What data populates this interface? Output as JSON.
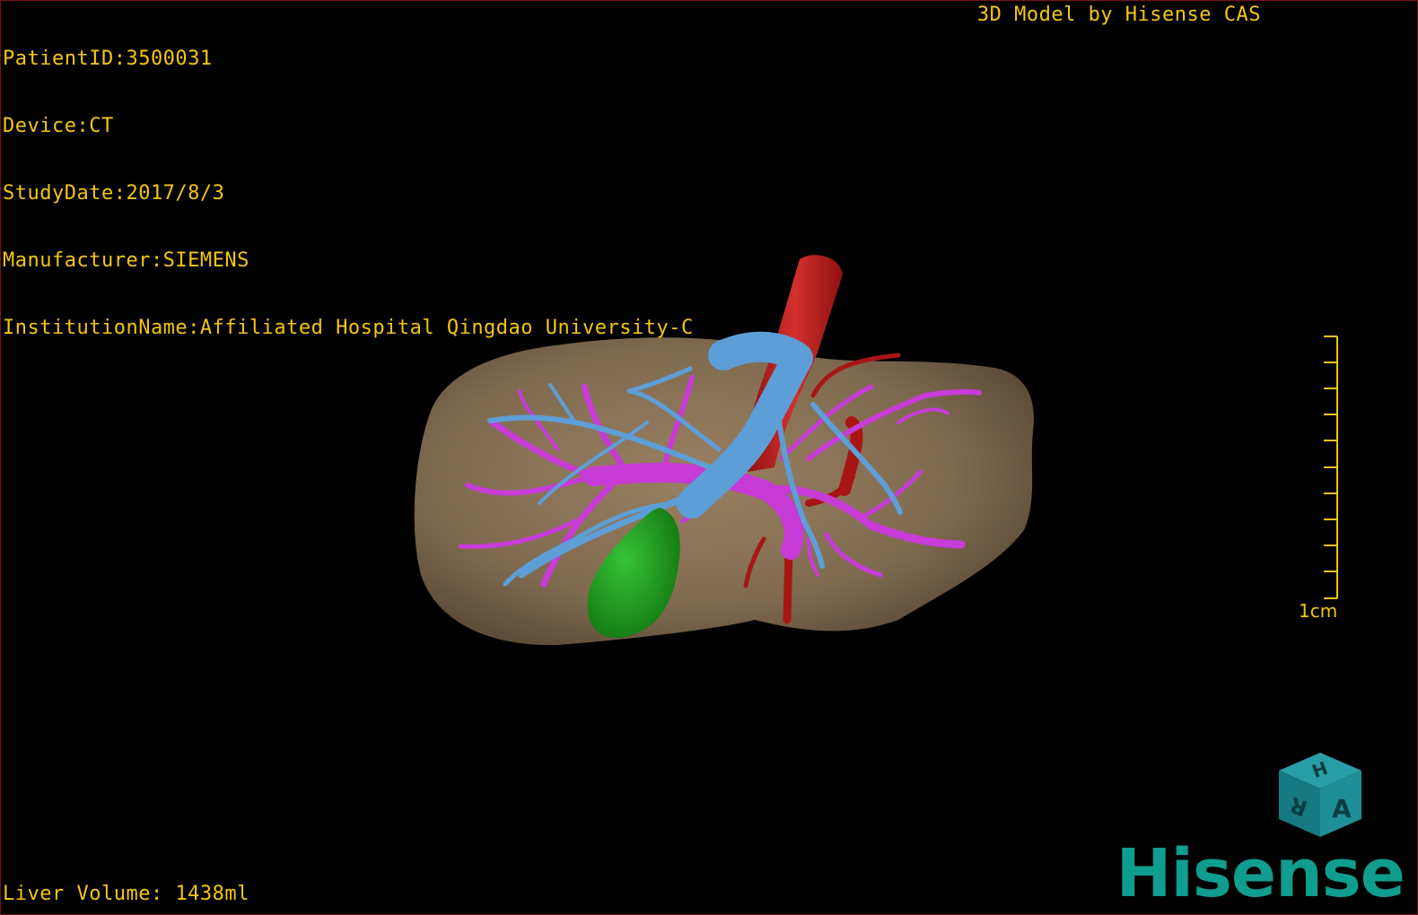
{
  "overlay": {
    "patient_id": "PatientID:3500031",
    "device": "Device:CT",
    "study_date": "StudyDate:2017/8/3",
    "manufacturer": "Manufacturer:SIEMENS",
    "institution": "InstitutionName:Affiliated Hospital Qingdao University-C",
    "vendor_caption": "3D Model by Hisense CAS",
    "liver_volume": "Liver Volume: 1438ml"
  },
  "scale": {
    "label": "1cm"
  },
  "orientation_cube": {
    "faces": [
      "H",
      "R",
      "A"
    ]
  },
  "brand": {
    "logo_text": "Hisense"
  },
  "colors": {
    "overlay_text": "#f4c60f",
    "liver": "#8a7256",
    "portal_vein": "#c83ad6",
    "hepatic_vein": "#5f9fd8",
    "artery": "#b31717",
    "gallbladder": "#1fa51f",
    "brand": "#0f9d8f"
  },
  "icons": {
    "cube": "orientation-cube-icon"
  }
}
